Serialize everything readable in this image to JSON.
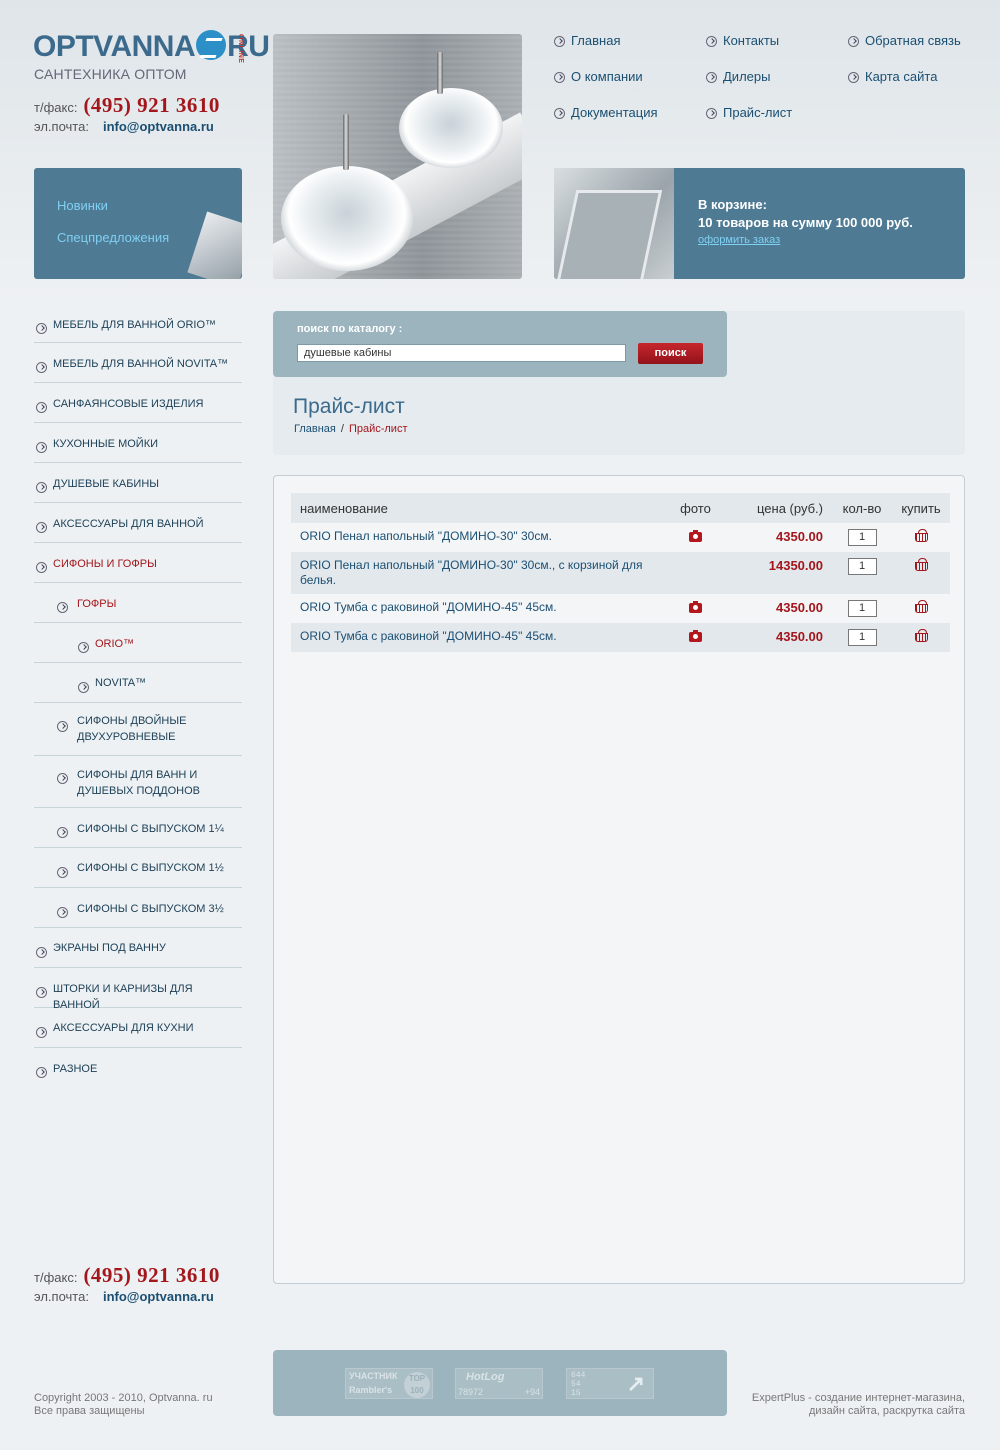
{
  "logo": {
    "text_left": "OPTVANNA",
    "text_right": "RU",
    "online": "ONLINE",
    "tagline": "САНТЕХНИКА ОПТОМ"
  },
  "contacts": {
    "phone_label": "т/факс:",
    "phone": "(495) 921 3610",
    "email_label": "эл.почта:",
    "email": "info@optvanna.ru"
  },
  "promo": {
    "new": "Новинки",
    "special": "Спецпредложения"
  },
  "top_nav": [
    {
      "label": "Главная"
    },
    {
      "label": "Контакты"
    },
    {
      "label": "Обратная связь"
    },
    {
      "label": "О компании"
    },
    {
      "label": "Дилеры"
    },
    {
      "label": "Карта сайта"
    },
    {
      "label": "Документация"
    },
    {
      "label": "Прайс-лист"
    }
  ],
  "cart": {
    "title": "В корзине:",
    "summary": "10 товаров на сумму 100 000 руб.",
    "order_link": "оформить заказ"
  },
  "sidebar": {
    "items": [
      {
        "label": "МЕБЕЛЬ ДЛЯ ВАННОЙ ORIO™"
      },
      {
        "label": "МЕБЕЛЬ ДЛЯ ВАННОЙ NOVITA™"
      },
      {
        "label": "САНФАЯНСОВЫЕ ИЗДЕЛИЯ"
      },
      {
        "label": "КУХОННЫЕ МОЙКИ"
      },
      {
        "label": "ДУШЕВЫЕ КАБИНЫ"
      },
      {
        "label": "АКСЕССУАРЫ ДЛЯ ВАННОЙ"
      },
      {
        "label": "СИФОНЫ И ГОФРЫ"
      },
      {
        "label": "ГОФРЫ"
      },
      {
        "label": "ORIO™"
      },
      {
        "label": "NOVITA™"
      },
      {
        "label": "СИФОНЫ ДВОЙНЫЕ ДВУХУРОВНЕВЫЕ"
      },
      {
        "label": "СИФОНЫ ДЛЯ ВАНН И ДУШЕВЫХ ПОДДОНОВ"
      },
      {
        "label": "СИФОНЫ С ВЫПУСКОМ 1¼"
      },
      {
        "label": "СИФОНЫ С ВЫПУСКОМ 1½"
      },
      {
        "label": "СИФОНЫ С ВЫПУСКОМ 3½"
      },
      {
        "label": "ЭКРАНЫ ПОД ВАННУ"
      },
      {
        "label": "ШТОРКИ И КАРНИЗЫ ДЛЯ ВАННОЙ"
      },
      {
        "label": "АКСЕССУАРЫ ДЛЯ КУХНИ"
      },
      {
        "label": "РАЗНОЕ"
      }
    ]
  },
  "search": {
    "label": "поиск по каталогу :",
    "value": "душевые кабины",
    "button": "поиск"
  },
  "page": {
    "title": "Прайс-лист",
    "breadcrumb_home": "Главная",
    "breadcrumb_sep": "/",
    "breadcrumb_current": "Прайс-лист"
  },
  "table": {
    "headers": {
      "name": "наименование",
      "photo": "фото",
      "price": "цена (руб.)",
      "qty": "кол-во",
      "buy": "купить"
    },
    "rows": [
      {
        "name": "ORIO Пенал напольный \"ДОМИНО-30\" 30см.",
        "price": "4350.00",
        "qty": "1"
      },
      {
        "name": "ORIO Пенал напольный \"ДОМИНО-30\" 30см., с корзиной для белья.",
        "price": "14350.00",
        "qty": "1"
      },
      {
        "name": "ORIO Тумба с раковиной \"ДОМИНО-45\" 45см.",
        "price": "4350.00",
        "qty": "1"
      },
      {
        "name": "ORIO Тумба с раковиной \"ДОМИНО-45\" 45см.",
        "price": "4350.00",
        "qty": "1"
      }
    ]
  },
  "footer": {
    "counter1": {
      "top": "УЧАСТНИК",
      "bottom": "Rambler's",
      "badge": "TOP 100"
    },
    "counter2": {
      "top": "HotLog",
      "left": "78972",
      "right": "+94"
    },
    "counter3": {
      "lines": "644 54 15"
    },
    "copyright1": "Copyright 2003 - 2010, Optvanna. ru",
    "copyright2": "Все права защищены",
    "dev1": "ExpertPlus - создание интернет-магазина,",
    "dev2": "дизайн сайта, раскрутка сайта"
  }
}
